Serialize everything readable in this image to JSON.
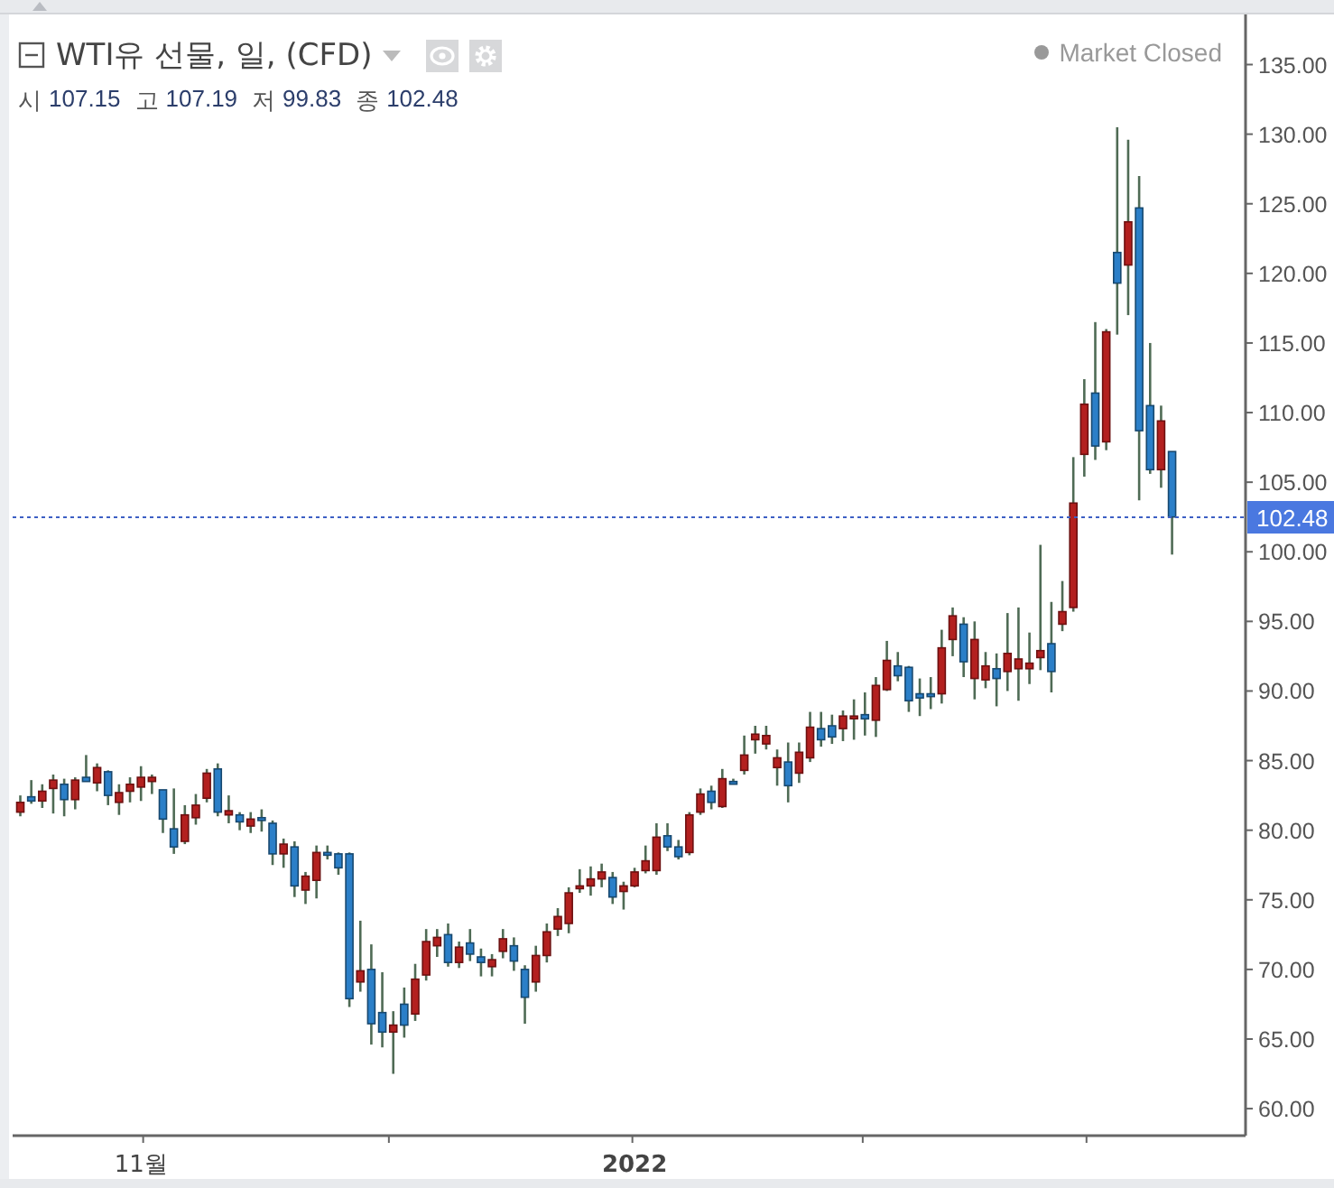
{
  "legend": {
    "title": "WTI유 선물, 일, (CFD)",
    "ohlc": [
      {
        "label": "시",
        "value": "107.15"
      },
      {
        "label": "고",
        "value": "107.19"
      },
      {
        "label": "저",
        "value": "99.83"
      },
      {
        "label": "종",
        "value": "102.48"
      }
    ]
  },
  "market_status": {
    "text": "Market Closed"
  },
  "chart": {
    "chart_data": {
      "type": "candlestick",
      "ylim": [
        58.06,
        138.6
      ],
      "categories": [
        null,
        null,
        null,
        null,
        null,
        null,
        null,
        null,
        null,
        null,
        null,
        "11월",
        null,
        null,
        null,
        null,
        null,
        null,
        null,
        null,
        null,
        null,
        null,
        null,
        null,
        null,
        null,
        null,
        null,
        null,
        null,
        null,
        null,
        null,
        null,
        null,
        null,
        null,
        null,
        null,
        null,
        null,
        null,
        null,
        null,
        null,
        null,
        null,
        null,
        null,
        null,
        null,
        null,
        null,
        null,
        null,
        "2022",
        null,
        null,
        null,
        null,
        null,
        null,
        null,
        null,
        null,
        null,
        null,
        null,
        null,
        null,
        null,
        null,
        null,
        null,
        null,
        null,
        null,
        null,
        null,
        null,
        null,
        null,
        null,
        null,
        null,
        null,
        null,
        null,
        null,
        null,
        null,
        null,
        null,
        null,
        null,
        null,
        null,
        null,
        null,
        null,
        null,
        null,
        null,
        null,
        null
      ],
      "yticks": [
        {
          "value": 60,
          "label": "60.00"
        },
        {
          "value": 65,
          "label": "65.00"
        },
        {
          "value": 70,
          "label": "70.00"
        },
        {
          "value": 75,
          "label": "75.00"
        },
        {
          "value": 80,
          "label": "80.00"
        },
        {
          "value": 85,
          "label": "85.00"
        },
        {
          "value": 90,
          "label": "90.00"
        },
        {
          "value": 95,
          "label": "95.00"
        },
        {
          "value": 100,
          "label": "100.00"
        },
        {
          "value": 105,
          "label": "105.00"
        },
        {
          "value": 110,
          "label": "110.00"
        },
        {
          "value": 115,
          "label": "115.00"
        },
        {
          "value": 120,
          "label": "120.00"
        },
        {
          "value": 125,
          "label": "125.00"
        },
        {
          "value": 130,
          "label": "130.00"
        },
        {
          "value": 135,
          "label": "135.00"
        }
      ],
      "ohlc": [
        [
          81.3,
          82.5,
          81.0,
          82.0
        ],
        [
          82.4,
          83.6,
          81.9,
          82.1
        ],
        [
          82.1,
          83.3,
          81.6,
          82.8
        ],
        [
          83.0,
          84.0,
          81.2,
          83.6
        ],
        [
          83.3,
          83.7,
          81.0,
          82.2
        ],
        [
          82.2,
          83.8,
          81.5,
          83.6
        ],
        [
          83.8,
          85.4,
          83.5,
          83.5
        ],
        [
          83.4,
          84.8,
          82.8,
          84.5
        ],
        [
          84.2,
          84.3,
          81.8,
          82.5
        ],
        [
          82.0,
          83.3,
          81.1,
          82.7
        ],
        [
          82.8,
          83.8,
          82.0,
          83.3
        ],
        [
          83.1,
          84.6,
          82.1,
          83.8
        ],
        [
          83.5,
          84.0,
          82.6,
          83.8
        ],
        [
          82.9,
          82.9,
          79.8,
          80.8
        ],
        [
          80.1,
          83.0,
          78.3,
          78.8
        ],
        [
          79.2,
          81.8,
          79.0,
          81.1
        ],
        [
          80.9,
          82.6,
          80.4,
          81.8
        ],
        [
          82.3,
          84.4,
          82.0,
          84.1
        ],
        [
          84.4,
          84.8,
          81.0,
          81.3
        ],
        [
          81.1,
          82.5,
          80.5,
          81.4
        ],
        [
          81.1,
          81.3,
          80.0,
          80.6
        ],
        [
          80.3,
          81.3,
          79.8,
          80.8
        ],
        [
          80.9,
          81.5,
          79.9,
          80.7
        ],
        [
          80.5,
          80.7,
          77.5,
          78.3
        ],
        [
          78.3,
          79.4,
          77.3,
          79.0
        ],
        [
          78.8,
          79.2,
          75.2,
          76.0
        ],
        [
          75.7,
          77.0,
          74.7,
          76.7
        ],
        [
          76.4,
          78.9,
          75.1,
          78.4
        ],
        [
          78.4,
          78.9,
          77.9,
          78.3
        ],
        [
          78.3,
          78.4,
          76.8,
          77.3
        ],
        [
          78.3,
          78.4,
          67.3,
          67.9
        ],
        [
          69.1,
          73.5,
          68.4,
          69.9
        ],
        [
          70.0,
          71.8,
          64.6,
          66.1
        ],
        [
          66.9,
          69.8,
          64.4,
          65.5
        ],
        [
          65.5,
          67.0,
          62.5,
          66.0
        ],
        [
          67.5,
          68.7,
          65.1,
          66.0
        ],
        [
          66.8,
          70.4,
          66.3,
          69.3
        ],
        [
          69.6,
          72.9,
          69.2,
          72.0
        ],
        [
          71.7,
          72.9,
          70.9,
          72.3
        ],
        [
          72.5,
          73.3,
          70.2,
          70.5
        ],
        [
          70.5,
          72.0,
          70.1,
          71.6
        ],
        [
          71.9,
          72.9,
          70.6,
          71.1
        ],
        [
          70.9,
          71.5,
          69.5,
          70.5
        ],
        [
          70.2,
          71.1,
          69.5,
          70.7
        ],
        [
          71.3,
          72.9,
          70.8,
          72.2
        ],
        [
          71.7,
          72.3,
          69.9,
          70.6
        ],
        [
          70.0,
          70.3,
          66.1,
          68.0
        ],
        [
          69.1,
          71.7,
          68.4,
          71.0
        ],
        [
          71.0,
          73.3,
          70.5,
          72.7
        ],
        [
          72.9,
          74.4,
          72.4,
          73.8
        ],
        [
          73.3,
          75.9,
          72.6,
          75.5
        ],
        [
          75.8,
          77.2,
          75.5,
          76.0
        ],
        [
          76.0,
          77.4,
          75.3,
          76.5
        ],
        [
          76.5,
          77.6,
          75.9,
          77.0
        ],
        [
          76.6,
          77.0,
          74.7,
          75.2
        ],
        [
          75.6,
          76.3,
          74.3,
          76.0
        ],
        [
          76.0,
          77.3,
          75.9,
          77.0
        ],
        [
          77.1,
          78.9,
          76.9,
          77.8
        ],
        [
          77.1,
          80.5,
          76.8,
          79.5
        ],
        [
          79.6,
          80.5,
          78.5,
          78.8
        ],
        [
          78.8,
          79.3,
          77.9,
          78.1
        ],
        [
          78.4,
          81.3,
          78.2,
          81.1
        ],
        [
          81.3,
          83.0,
          81.1,
          82.6
        ],
        [
          82.8,
          83.2,
          81.5,
          82.0
        ],
        [
          81.7,
          84.4,
          81.6,
          83.7
        ],
        [
          83.5,
          83.7,
          83.3,
          83.4
        ],
        [
          84.3,
          86.8,
          84.0,
          85.4
        ],
        [
          86.5,
          87.5,
          85.5,
          86.9
        ],
        [
          86.2,
          87.5,
          85.8,
          86.8
        ],
        [
          84.5,
          85.8,
          83.2,
          85.2
        ],
        [
          84.9,
          86.3,
          82.0,
          83.2
        ],
        [
          84.1,
          86.3,
          83.4,
          85.6
        ],
        [
          85.2,
          88.5,
          84.9,
          87.4
        ],
        [
          87.3,
          88.5,
          86.0,
          86.5
        ],
        [
          87.5,
          88.3,
          86.2,
          86.7
        ],
        [
          87.3,
          88.6,
          86.4,
          88.2
        ],
        [
          88.1,
          89.4,
          86.5,
          88.2
        ],
        [
          88.3,
          89.9,
          86.8,
          88.0
        ],
        [
          87.9,
          91.0,
          86.7,
          90.4
        ],
        [
          90.1,
          93.6,
          90.0,
          92.2
        ],
        [
          91.8,
          92.8,
          90.7,
          91.1
        ],
        [
          91.7,
          91.8,
          88.5,
          89.3
        ],
        [
          89.8,
          90.9,
          88.2,
          89.5
        ],
        [
          89.8,
          91.0,
          88.7,
          89.6
        ],
        [
          89.8,
          94.4,
          89.1,
          93.1
        ],
        [
          93.7,
          96.0,
          92.5,
          95.4
        ],
        [
          94.8,
          95.3,
          91.0,
          92.1
        ],
        [
          90.9,
          95.0,
          89.4,
          93.7
        ],
        [
          90.8,
          92.8,
          90.2,
          91.8
        ],
        [
          91.6,
          92.7,
          88.9,
          90.9
        ],
        [
          91.4,
          95.6,
          90.0,
          92.7
        ],
        [
          91.6,
          96.0,
          89.3,
          92.3
        ],
        [
          91.6,
          94.2,
          90.5,
          92.0
        ],
        [
          92.4,
          100.5,
          91.5,
          92.9
        ],
        [
          93.4,
          96.4,
          89.9,
          91.4
        ],
        [
          94.8,
          97.9,
          94.3,
          95.7
        ],
        [
          96.0,
          106.8,
          95.7,
          103.5
        ],
        [
          107.0,
          112.4,
          105.4,
          110.6
        ],
        [
          111.4,
          116.5,
          106.6,
          107.6
        ],
        [
          107.9,
          116.0,
          107.3,
          115.8
        ],
        [
          121.5,
          130.5,
          115.6,
          119.3
        ],
        [
          120.6,
          129.6,
          117.0,
          123.7
        ],
        [
          124.7,
          127.0,
          103.7,
          108.7
        ],
        [
          110.5,
          115.0,
          105.6,
          105.9
        ],
        [
          105.9,
          110.5,
          104.6,
          109.4
        ],
        [
          107.2,
          107.2,
          99.8,
          102.5
        ]
      ],
      "ref_lines": [
        {
          "axis": "y",
          "value": 102.48,
          "label": "102.48"
        }
      ]
    }
  }
}
